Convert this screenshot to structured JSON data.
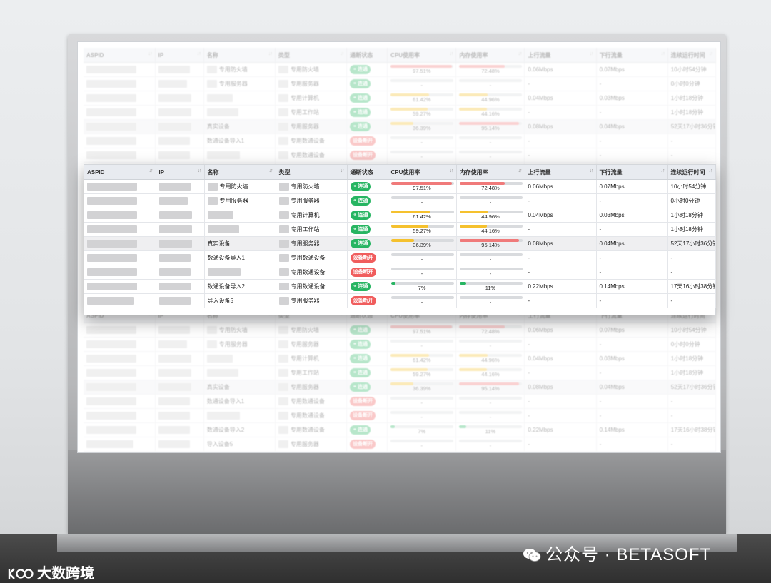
{
  "columns": [
    {
      "key": "aspid",
      "label": "ASPID",
      "width": 100
    },
    {
      "key": "ip",
      "label": "IP",
      "width": 68
    },
    {
      "key": "name",
      "label": "名称",
      "width": 100
    },
    {
      "key": "type",
      "label": "类型",
      "width": 100
    },
    {
      "key": "status",
      "label": "通断状态",
      "width": 57
    },
    {
      "key": "cpu",
      "label": "CPU使用率",
      "width": 96
    },
    {
      "key": "mem",
      "label": "内存使用率",
      "width": 96
    },
    {
      "key": "up",
      "label": "上行流量",
      "width": 100
    },
    {
      "key": "down",
      "label": "下行流量",
      "width": 100
    },
    {
      "key": "uptime",
      "label": "连续运行时间",
      "width": 67
    }
  ],
  "status_labels": {
    "online": "连通",
    "offline": "设备断开"
  },
  "status_colors": {
    "online": "#27b562",
    "offline": "#f05d5d"
  },
  "bar_colors": {
    "high": "#f07a7a",
    "mid": "#f5c12e",
    "low": "#27b562"
  },
  "rows": [
    {
      "name": "",
      "type": "专用防火墙",
      "status": "online",
      "cpu": 97.51,
      "cpu_label": "97.51%",
      "mem": 72.48,
      "mem_label": "72.48%",
      "up": "0.06Mbps",
      "down": "0.07Mbps",
      "uptime": "10小时54分钟",
      "highlight": false
    },
    {
      "name": "",
      "type": "专用服务器",
      "status": "online",
      "cpu": 0,
      "cpu_label": "-",
      "mem": 0,
      "mem_label": "-",
      "up": "-",
      "down": "-",
      "uptime": "0小时0分钟",
      "highlight": false
    },
    {
      "name": "",
      "type": "专用计算机",
      "status": "online",
      "cpu": 61.42,
      "cpu_label": "61.42%",
      "mem": 44.96,
      "mem_label": "44.96%",
      "up": "0.04Mbps",
      "down": "0.03Mbps",
      "uptime": "1小时18分钟",
      "highlight": false
    },
    {
      "name": "",
      "type": "专用工作站",
      "status": "online",
      "cpu": 59.27,
      "cpu_label": "59.27%",
      "mem": 44.16,
      "mem_label": "44.16%",
      "up": "-",
      "down": "-",
      "uptime": "1小时18分钟",
      "highlight": false
    },
    {
      "name": "真实设备",
      "type": "专用服务器",
      "status": "online",
      "cpu": 36.39,
      "cpu_label": "36.39%",
      "mem": 95.14,
      "mem_label": "95.14%",
      "up": "0.08Mbps",
      "down": "0.04Mbps",
      "uptime": "52天17小时36分钟",
      "highlight": true
    },
    {
      "name": "数通设备导入1",
      "type": "专用数通设备",
      "status": "offline",
      "cpu": 0,
      "cpu_label": "-",
      "mem": 0,
      "mem_label": "-",
      "up": "-",
      "down": "-",
      "uptime": "-",
      "highlight": false
    },
    {
      "name": "",
      "type": "专用数通设备",
      "status": "offline",
      "cpu": 0,
      "cpu_label": "-",
      "mem": 0,
      "mem_label": "-",
      "up": "-",
      "down": "-",
      "uptime": "-",
      "highlight": false
    },
    {
      "name": "数通设备导入2",
      "type": "专用数通设备",
      "status": "online",
      "cpu": 7,
      "cpu_label": "7%",
      "mem": 11,
      "mem_label": "11%",
      "up": "0.22Mbps",
      "down": "0.14Mbps",
      "uptime": "17天16小时38分钟",
      "highlight": false
    },
    {
      "name": "导入设备5",
      "type": "专用服务器",
      "status": "offline",
      "cpu": 0,
      "cpu_label": "-",
      "mem": 0,
      "mem_label": "-",
      "up": "-",
      "down": "-",
      "uptime": "-",
      "highlight": false
    }
  ],
  "watermark_account": "公众号 · BETASOFT",
  "watermark_brand": "大数跨境"
}
